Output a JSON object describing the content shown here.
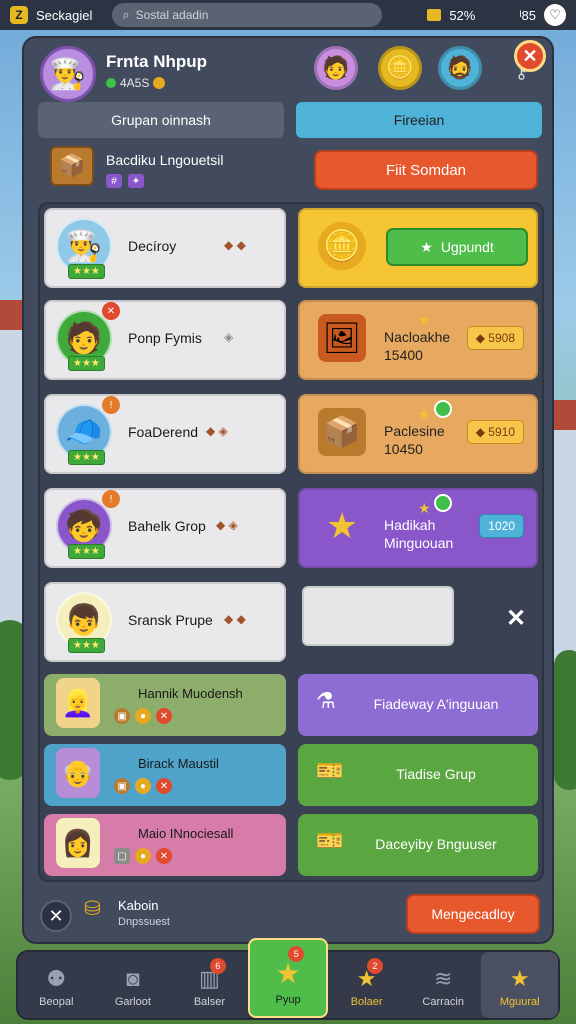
{
  "statusbar": {
    "app_name": "Seckagiel",
    "search_placeholder": "Sostal adadin",
    "battery": "52%",
    "time": "ᴵ85"
  },
  "profile": {
    "name": "Frnta Nhpup",
    "sub": "4A5S"
  },
  "tabs": {
    "left": "Grupan oinnash",
    "right": "Fireeian"
  },
  "group": {
    "title": "Bacdiku Lngouetsil",
    "action": "Fiit Somdan"
  },
  "rows": [
    {
      "name": "Decíroy"
    },
    {
      "name": "Ponp Fymis"
    },
    {
      "name": "FoaDerend"
    },
    {
      "name": "Bahelk Grop"
    },
    {
      "name": "Sransk Prupe"
    }
  ],
  "rewards": [
    {
      "button": "Ugpundt"
    },
    {
      "title": "Nacloakhe",
      "sub": "15400",
      "price": "5908"
    },
    {
      "title": "Paclesine",
      "sub": "10450",
      "price": "5910"
    },
    {
      "title": "Hadikah",
      "sub": "Minguouan",
      "price": "1020"
    }
  ],
  "lower_rows": [
    {
      "name": "Hannik Muodensh"
    },
    {
      "name": "Birack Maustil"
    },
    {
      "name": "Maio INnociesall"
    }
  ],
  "lower_actions": [
    {
      "label": "Fiadeway A'inguuan"
    },
    {
      "label": "Tiadise Grup"
    },
    {
      "label": "Daceyiby Bnguuser"
    }
  ],
  "footer": {
    "title": "Kaboin",
    "sub": "Dnpssuest",
    "manage": "Mengecadloy"
  },
  "nav": [
    {
      "label": "Beopal",
      "badge": ""
    },
    {
      "label": "Garloot",
      "badge": ""
    },
    {
      "label": "Balser",
      "badge": "6"
    },
    {
      "label": "Pyup",
      "badge": "5"
    },
    {
      "label": "Bolaer",
      "badge": "2"
    },
    {
      "label": "Carracin",
      "badge": ""
    },
    {
      "label": "Mguural",
      "badge": ""
    }
  ]
}
